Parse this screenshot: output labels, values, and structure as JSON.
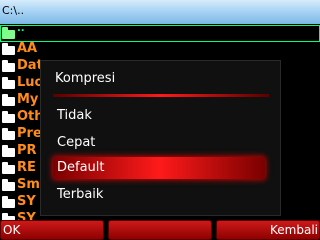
{
  "title_bar": {
    "path": "C:\\.."
  },
  "file_list": {
    "items": [
      {
        "label": "..",
        "selected": true
      },
      {
        "label": "AA"
      },
      {
        "label": "Dat"
      },
      {
        "label": "Luo"
      },
      {
        "label": "My"
      },
      {
        "label": "Oth"
      },
      {
        "label": "Pre"
      },
      {
        "label": "PR"
      },
      {
        "label": "RE"
      },
      {
        "label": "Sm"
      },
      {
        "label": "SY"
      },
      {
        "label": "SY"
      }
    ]
  },
  "dialog": {
    "title": "Kompresi",
    "options": [
      {
        "label": "Tidak"
      },
      {
        "label": "Cepat"
      },
      {
        "label": "Default",
        "selected": true
      },
      {
        "label": "Terbaik"
      }
    ]
  },
  "softkeys": {
    "left": "OK",
    "center": "",
    "right": "Kembali"
  },
  "colors": {
    "accent": "#ff1a1a",
    "folder_label": "#ff8c1a",
    "selection_green": "#00ff7f"
  },
  "icons": {
    "folder": "folder-icon"
  }
}
